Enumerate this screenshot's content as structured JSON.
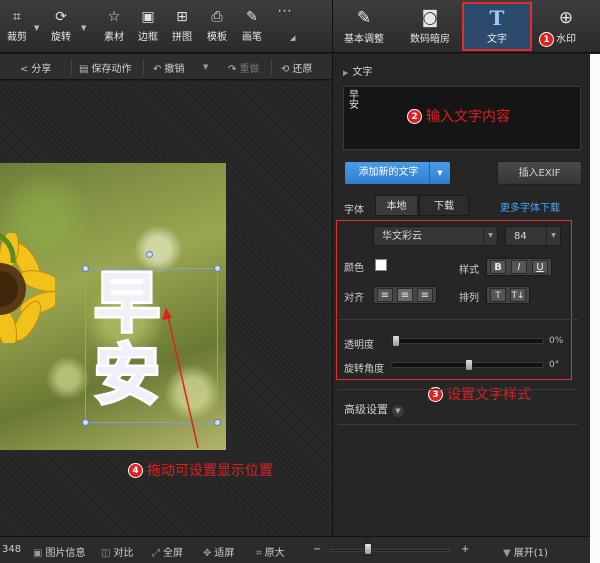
{
  "toolbar": {
    "tools": [
      {
        "name": "crop",
        "label": "裁剪",
        "icon": "crop-icon"
      },
      {
        "name": "rotate",
        "label": "旋转",
        "icon": "rotate-icon"
      },
      {
        "name": "material",
        "label": "素材",
        "icon": "star-icon"
      },
      {
        "name": "border",
        "label": "边框",
        "icon": "border-icon"
      },
      {
        "name": "collage",
        "label": "拼图",
        "icon": "grid-icon"
      },
      {
        "name": "template",
        "label": "模板",
        "icon": "printer-icon"
      },
      {
        "name": "brush",
        "label": "画笔",
        "icon": "brush-icon"
      },
      {
        "name": "more",
        "label": "···",
        "icon": "more-icon"
      }
    ]
  },
  "right_tabs": [
    {
      "label": "基本调整",
      "icon": "adjust-icon"
    },
    {
      "label": "数码暗房",
      "icon": "camera-icon"
    },
    {
      "label": "文字",
      "icon": "text-T-icon",
      "active": true
    },
    {
      "label": "水印",
      "icon": "watermark-icon"
    }
  ],
  "toolbar2": {
    "share": "分享",
    "save_action": "保存动作",
    "undo": "撤销",
    "redo": "重做",
    "restore": "还原"
  },
  "panel": {
    "title": "文字",
    "text_content": "早\n安",
    "add_text_button": "添加新的文字",
    "insert_exif_button": "插入EXIF",
    "font_label": "字体",
    "font_tabs": [
      "本地",
      "下载"
    ],
    "more_fonts_link": "更多字体下载",
    "font_name": "华文彩云",
    "font_size": "84",
    "color_label": "颜色",
    "style_label": "样式",
    "style_buttons": [
      "B",
      "I",
      "U"
    ],
    "align_label": "对齐",
    "order_label": "排列",
    "opacity_label": "透明度",
    "opacity_value": "0%",
    "opacity_level": 0,
    "rotation_label": "旋转角度",
    "rotation_value": "0°",
    "rotation_level": 0.5,
    "advanced_label": "高级设置"
  },
  "canvas": {
    "photo_text": [
      "早",
      "安"
    ]
  },
  "annotations": [
    {
      "num": "1",
      "text": ""
    },
    {
      "num": "2",
      "text": "输入文字内容"
    },
    {
      "num": "3",
      "text": "设置文字样式"
    },
    {
      "num": "4",
      "text": "拖动可设置显示位置"
    }
  ],
  "statusbar": {
    "left_number": "348",
    "image_info": "图片信息",
    "compare": "对比",
    "fullscreen": "全屏",
    "fit_screen": "适屏",
    "original_size": "原大",
    "zoom_minus": "−",
    "zoom_plus": "+",
    "expand": "展开(1)",
    "zoom_level": 0.3
  },
  "colors": {
    "accent_blue": "#3a8ddd",
    "annotation_red": "#e02020",
    "link_blue": "#4da3f7"
  }
}
